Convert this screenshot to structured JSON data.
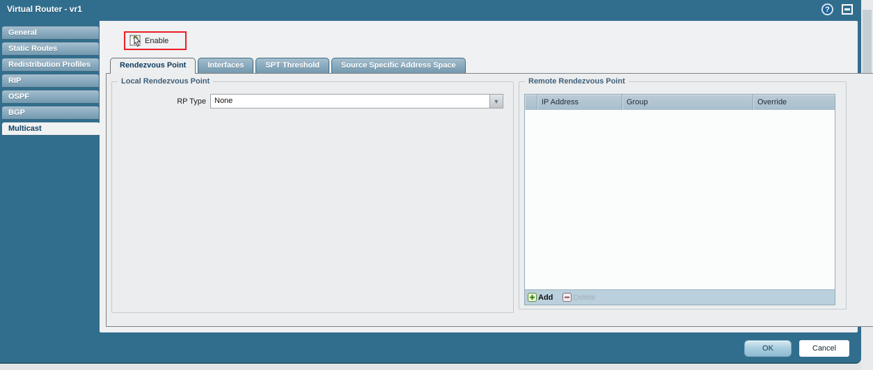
{
  "window": {
    "title": "Virtual Router - vr1",
    "help_icon": "question-mark-circle",
    "window_icon": "minimize-box"
  },
  "sidebar": {
    "items": [
      {
        "label": "General",
        "selected": false
      },
      {
        "label": "Static Routes",
        "selected": false
      },
      {
        "label": "Redistribution Profiles",
        "selected": false
      },
      {
        "label": "RIP",
        "selected": false
      },
      {
        "label": "OSPF",
        "selected": false
      },
      {
        "label": "BGP",
        "selected": false
      },
      {
        "label": "Multicast",
        "selected": true
      }
    ]
  },
  "toolbar": {
    "enable_label": "Enable",
    "enable_checked": false,
    "annotation": "red-highlight-box-with-mouse-cursor"
  },
  "tabs": {
    "items": [
      {
        "label": "Rendezvous Point",
        "selected": true
      },
      {
        "label": "Interfaces",
        "selected": false
      },
      {
        "label": "SPT Threshold",
        "selected": false
      },
      {
        "label": "Source Specific Address Space",
        "selected": false
      }
    ]
  },
  "local_rendezvous_point": {
    "legend": "Local Rendezvous Point",
    "rp_type": {
      "label": "RP Type",
      "value": "None"
    }
  },
  "remote_rendezvous_point": {
    "legend": "Remote Rendezvous Point",
    "table": {
      "columns": [
        "",
        "IP Address",
        "Group",
        "Override"
      ],
      "rows": []
    },
    "actions": {
      "add_label": "Add",
      "delete_label": "Delete",
      "delete_enabled": false
    }
  },
  "footer": {
    "ok_label": "OK",
    "cancel_label": "Cancel"
  },
  "icons": {
    "help": "?",
    "dropdown_arrow": "▼",
    "add": "+",
    "delete": "−",
    "cursor": "mouse-arrow"
  },
  "colors": {
    "titlebar_teal": "#316e8e",
    "annotation_red": "#ee1c25",
    "add_green": "#3c7d1c",
    "delete_maroon": "#8e4a55",
    "selected_text_navy": "#0e3e63",
    "panel_gray": "#ebedee",
    "grid_header_blue": "#b0c3d1"
  }
}
